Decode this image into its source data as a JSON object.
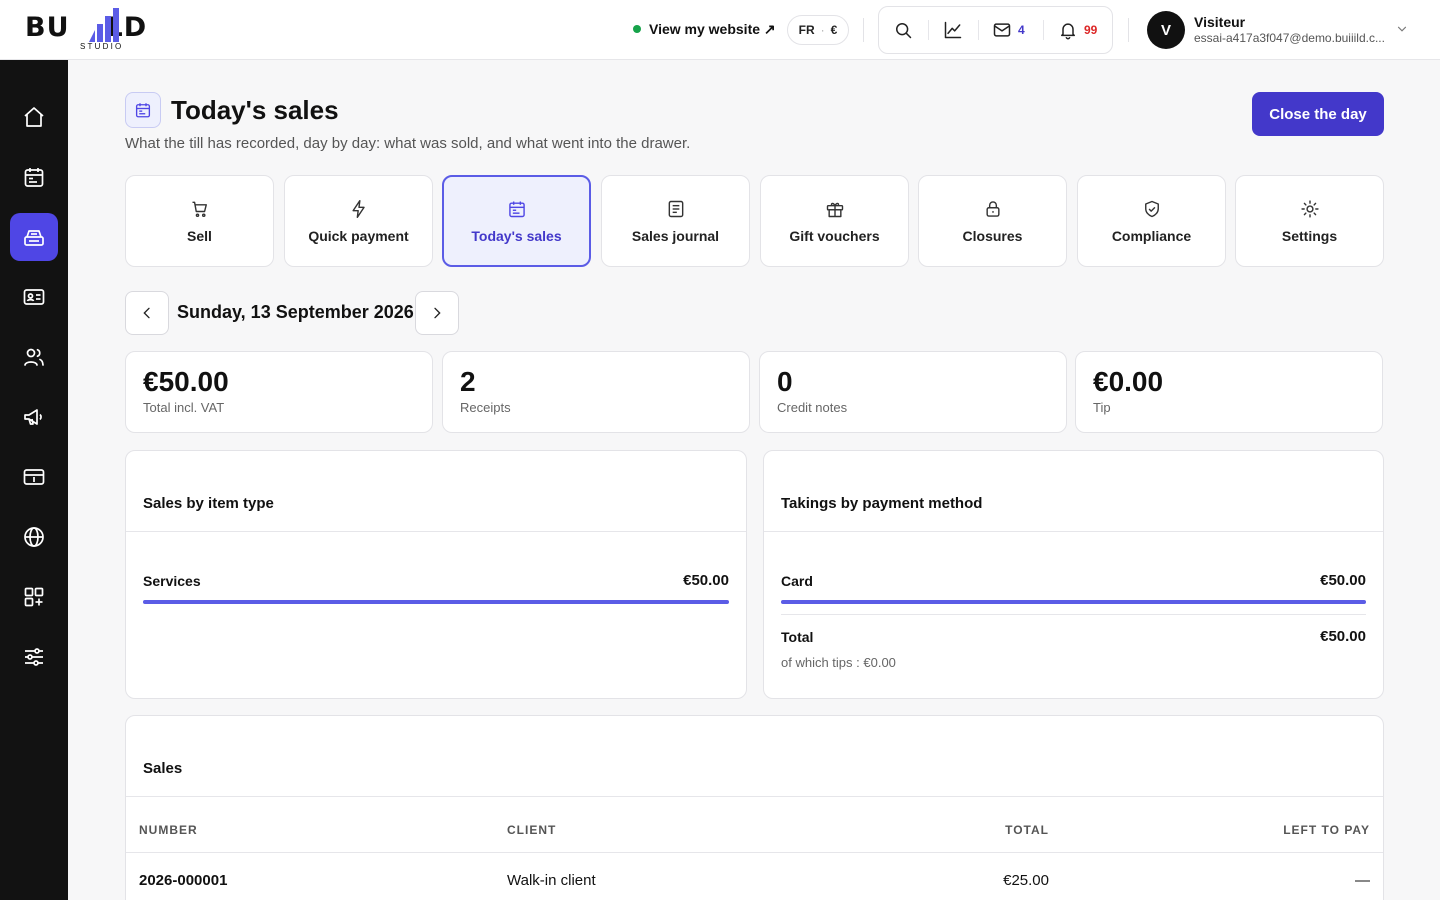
{
  "brand": {
    "logo_main": "BUILD",
    "logo_sub": "STUDIO"
  },
  "topbar": {
    "view_site": "View my website ↗",
    "lang": "FR",
    "currency": "€",
    "tools": [
      {
        "icon": "search-icon",
        "count": ""
      },
      {
        "icon": "chart-line-icon",
        "count": ""
      },
      {
        "icon": "mail-icon",
        "count": "4"
      },
      {
        "icon": "bell-icon",
        "count": "99"
      }
    ],
    "user": {
      "initial": "V",
      "name": "Visiteur",
      "email": "essai-a417a3f047@demo.buiiild.c..."
    }
  },
  "sidebar": {
    "items": [
      "home-icon",
      "calendar-icon",
      "register-icon",
      "contact-card-icon",
      "users-icon",
      "megaphone-icon",
      "payment-card-icon",
      "globe-icon",
      "apps-add-icon",
      "sliders-icon"
    ],
    "active_index": 2
  },
  "page": {
    "title": "Today's sales",
    "subtitle": "What the till has recorded, day by day: what was sold, and what went into the drawer.",
    "close_button": "Close the day"
  },
  "nav_cards": [
    {
      "label": "Sell",
      "icon": "cart-icon",
      "active": false
    },
    {
      "label": "Quick payment",
      "icon": "lightning-icon",
      "active": false
    },
    {
      "label": "Today's sales",
      "icon": "calendar-icon",
      "active": true
    },
    {
      "label": "Sales journal",
      "icon": "journal-icon",
      "active": false
    },
    {
      "label": "Gift vouchers",
      "icon": "gift-icon",
      "active": false
    },
    {
      "label": "Closures",
      "icon": "lock-icon",
      "active": false
    },
    {
      "label": "Compliance",
      "icon": "shield-check-icon",
      "active": false
    },
    {
      "label": "Settings",
      "icon": "sun-gear-icon",
      "active": false
    }
  ],
  "date": {
    "label": "Sunday, 13 September 2026"
  },
  "stats": [
    {
      "value": "€50.00",
      "label": "Total incl. VAT"
    },
    {
      "value": "2",
      "label": "Receipts"
    },
    {
      "value": "0",
      "label": "Credit notes"
    },
    {
      "value": "€0.00",
      "label": "Tip"
    }
  ],
  "sales_by_type": {
    "title": "Sales by item type",
    "rows": [
      {
        "label": "Services",
        "value": "€50.00",
        "share": 1.0
      }
    ]
  },
  "takings": {
    "title": "Takings by payment method",
    "rows": [
      {
        "label": "Card",
        "value": "€50.00",
        "share": 1.0
      }
    ],
    "total_label": "Total",
    "total_value": "€50.00",
    "tips_note": "of which tips : €0.00"
  },
  "sales_table": {
    "title": "Sales",
    "columns": [
      "NUMBER",
      "CLIENT",
      "TOTAL",
      "LEFT TO PAY"
    ],
    "rows": [
      [
        "2026-000001",
        "Walk-in client",
        "€25.00",
        "—"
      ]
    ]
  },
  "colors": {
    "accent": "#4f46e5",
    "primary_button": "#4338ca",
    "online_dot": "#16a34a",
    "mail_count": "#4338ca",
    "bell_count": "#dc2626"
  }
}
